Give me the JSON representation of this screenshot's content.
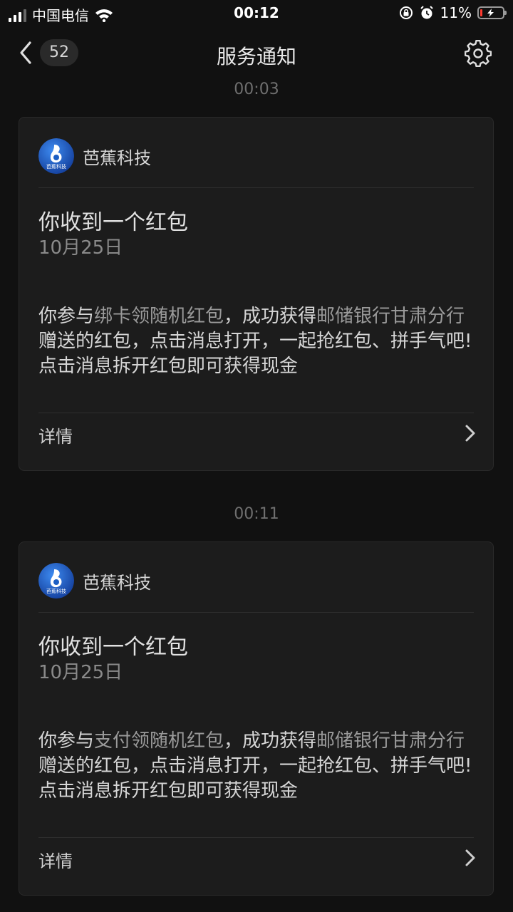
{
  "status_bar": {
    "carrier": "中国电信",
    "time": "00:12",
    "battery_percent": "11%",
    "battery_level": 0.11
  },
  "nav": {
    "back_icon": "chevron-left-icon",
    "unread_count": "52",
    "title": "服务通知",
    "settings_icon": "gear-icon"
  },
  "messages": [
    {
      "timestamp": "00:03",
      "brand": "芭蕉科技",
      "logo_text": "芭蕉科技",
      "title": "你收到一个红包",
      "date": "10月25日",
      "body": {
        "p1": "你参与",
        "h1": "绑卡领随机红包",
        "p2": "，成功获得",
        "h2": "邮储银行甘肃分行",
        "p3": "赠送的红包，点击消息打开，一起抢红包、拼手气吧!",
        "p4": "点击消息拆开红包即可获得现金"
      },
      "detail_label": "详情"
    },
    {
      "timestamp": "00:11",
      "brand": "芭蕉科技",
      "logo_text": "芭蕉科技",
      "title": "你收到一个红包",
      "date": "10月25日",
      "body": {
        "p1": "你参与",
        "h1": "支付领随机红包",
        "p2": "，成功获得",
        "h2": "邮储银行甘肃分行",
        "p3": "赠送的红包，点击消息打开，一起抢红包、拼手气吧!",
        "p4": "点击消息拆开红包即可获得现金"
      },
      "detail_label": "详情"
    }
  ],
  "colors": {
    "background": "#111111",
    "card": "#1c1c1c",
    "highlight_text": "#9a9a9a",
    "logo_blue": "#1d5fc4",
    "battery_low": "#ff3b30"
  }
}
